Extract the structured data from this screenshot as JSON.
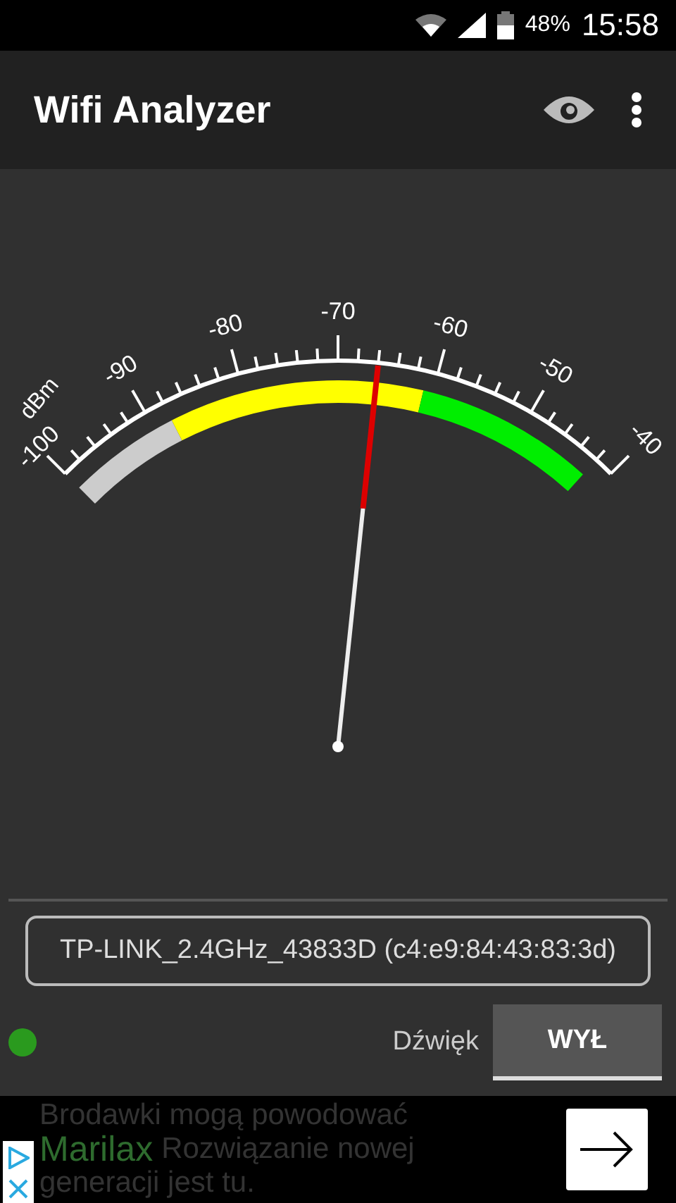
{
  "status_bar": {
    "battery": "48%",
    "time": "15:58"
  },
  "app_bar": {
    "title": "Wifi Analyzer"
  },
  "meter": {
    "unit": "dBm",
    "scale_labels": [
      "-100",
      "-90",
      "-80",
      "-70",
      "-60",
      "-50",
      "-40"
    ]
  },
  "network": {
    "value": "TP-LINK_2.4GHz_43833D (c4:e9:84:43:83:3d)"
  },
  "sound": {
    "label": "Dźwięk",
    "button": "WYŁ",
    "on": false
  },
  "ad": {
    "lines": [
      "Brodawki mogą powodować",
      "Rozwiązanie nowej",
      "generacji jest tu."
    ],
    "brand": "Marilax"
  }
}
